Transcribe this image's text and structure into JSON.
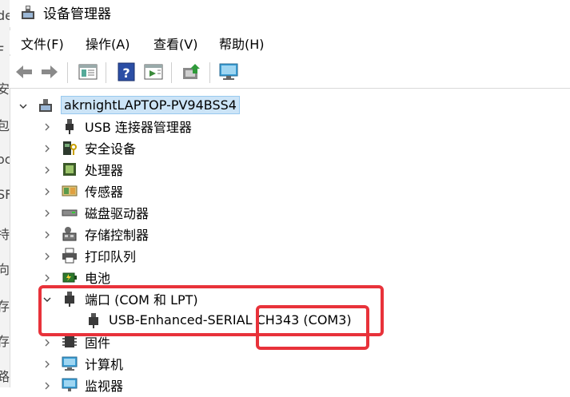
{
  "window": {
    "title": "设备管理器"
  },
  "background_fragments": [
    "de",
    "F",
    "安",
    "包",
    "oc",
    "SF",
    "持",
    "向",
    "存",
    "存",
    "路"
  ],
  "menu": [
    "文件(F)",
    "操作(A)",
    "查看(V)",
    "帮助(H)"
  ],
  "toolbar_icons": [
    "back-arrow-icon",
    "forward-arrow-icon",
    "properties-panel-icon",
    "help-icon",
    "update-driver-icon",
    "scan-hardware-icon",
    "monitor-icon"
  ],
  "tree": {
    "root": "akrnightLAPTOP-PV94BSS4",
    "items": [
      {
        "label": "USB 连接器管理器",
        "icon": "usb-connector-icon"
      },
      {
        "label": "安全设备",
        "icon": "security-device-icon"
      },
      {
        "label": "处理器",
        "icon": "processor-icon"
      },
      {
        "label": "传感器",
        "icon": "sensor-icon"
      },
      {
        "label": "磁盘驱动器",
        "icon": "disk-drive-icon"
      },
      {
        "label": "存储控制器",
        "icon": "storage-controller-icon"
      },
      {
        "label": "打印队列",
        "icon": "printer-icon"
      },
      {
        "label": "电池",
        "icon": "battery-icon"
      },
      {
        "label": "端口 (COM 和 LPT)",
        "icon": "port-icon",
        "expanded": true,
        "children": [
          {
            "label": "USB-Enhanced-SERIAL CH343 (COM3)",
            "icon": "serial-port-icon"
          }
        ]
      },
      {
        "label": "固件",
        "icon": "firmware-icon"
      },
      {
        "label": "计算机",
        "icon": "computer-icon"
      },
      {
        "label": "监视器",
        "icon": "monitor-icon"
      }
    ]
  },
  "colors": {
    "annotation": "#e8323a",
    "selection": "#cce4f7"
  }
}
